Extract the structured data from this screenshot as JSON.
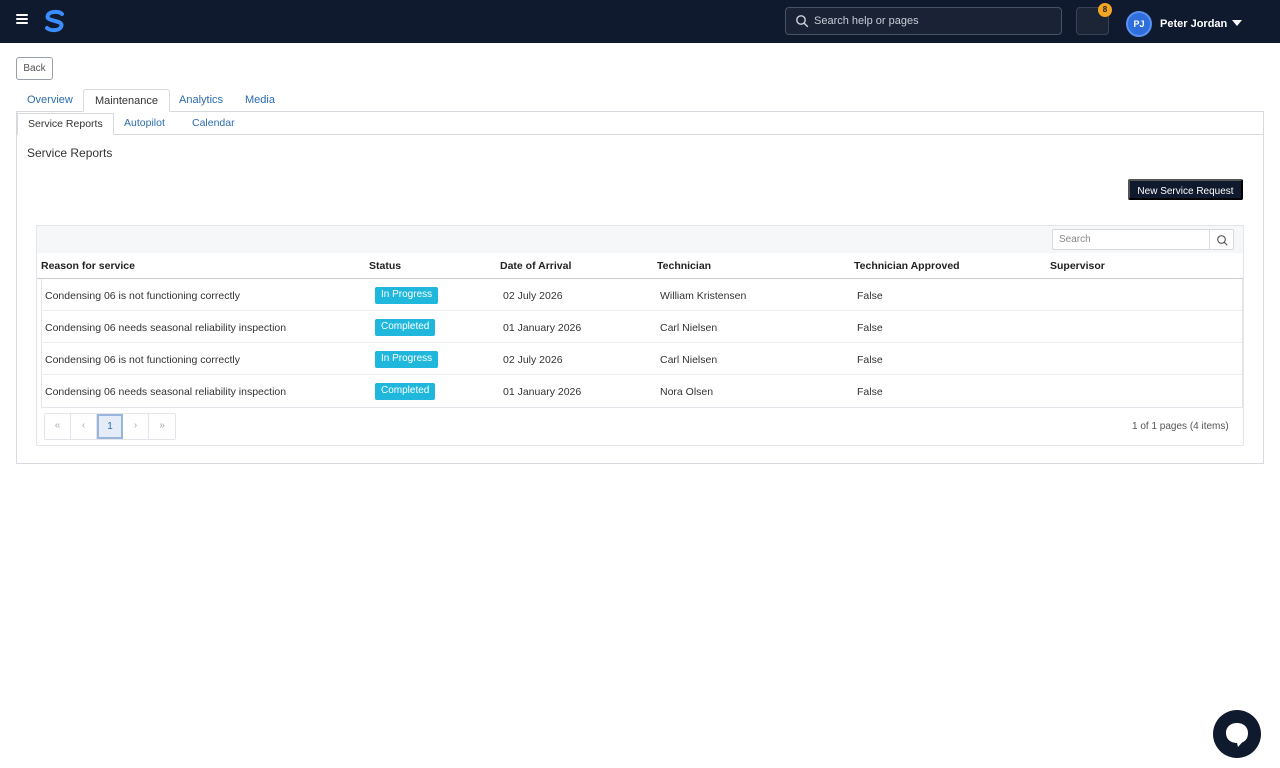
{
  "header": {
    "search_placeholder": "Search help or pages",
    "notification_count": "8",
    "user_initials": "PJ",
    "user_name": "Peter Jordan"
  },
  "back_label": "Back",
  "tabs": [
    {
      "label": "Overview"
    },
    {
      "label": "Maintenance"
    },
    {
      "label": "Analytics"
    },
    {
      "label": "Media"
    }
  ],
  "subtabs": [
    {
      "label": "Service Reports"
    },
    {
      "label": "Autopilot"
    },
    {
      "label": "Calendar"
    }
  ],
  "section_title": "Service Reports",
  "new_request_label": "New Service Request",
  "grid": {
    "search_placeholder": "Search",
    "columns": [
      "Reason for service",
      "Status",
      "Date of Arrival",
      "Technician",
      "Technician Approved",
      "Supervisor"
    ],
    "rows": [
      {
        "reason": "Condensing 06 is not functioning correctly",
        "status": "In Progress",
        "date": "02 July 2026",
        "technician": "William Kristensen",
        "approved": "False",
        "supervisor": ""
      },
      {
        "reason": "Condensing 06 needs seasonal reliability inspection",
        "status": "Completed",
        "date": "01 January 2026",
        "technician": "Carl Nielsen",
        "approved": "False",
        "supervisor": ""
      },
      {
        "reason": "Condensing 06 is not functioning correctly",
        "status": "In Progress",
        "date": "02 July 2026",
        "technician": "Carl Nielsen",
        "approved": "False",
        "supervisor": ""
      },
      {
        "reason": "Condensing 06 needs seasonal reliability inspection",
        "status": "Completed",
        "date": "01 January 2026",
        "technician": "Nora Olsen",
        "approved": "False",
        "supervisor": ""
      }
    ],
    "pager": {
      "first": "«",
      "prev": "‹",
      "current": "1",
      "next": "›",
      "last": "»",
      "info": "1 of 1 pages (4 items)"
    }
  },
  "colors": {
    "topbar": "#101a2e",
    "status_badge": "#1fb8dc",
    "link": "#2b6cb0",
    "notification_badge": "#f5a524"
  },
  "icons": [
    "menu-icon",
    "brand-logo-icon",
    "search-icon",
    "notification-icon",
    "caret-down-icon",
    "chat-icon"
  ]
}
